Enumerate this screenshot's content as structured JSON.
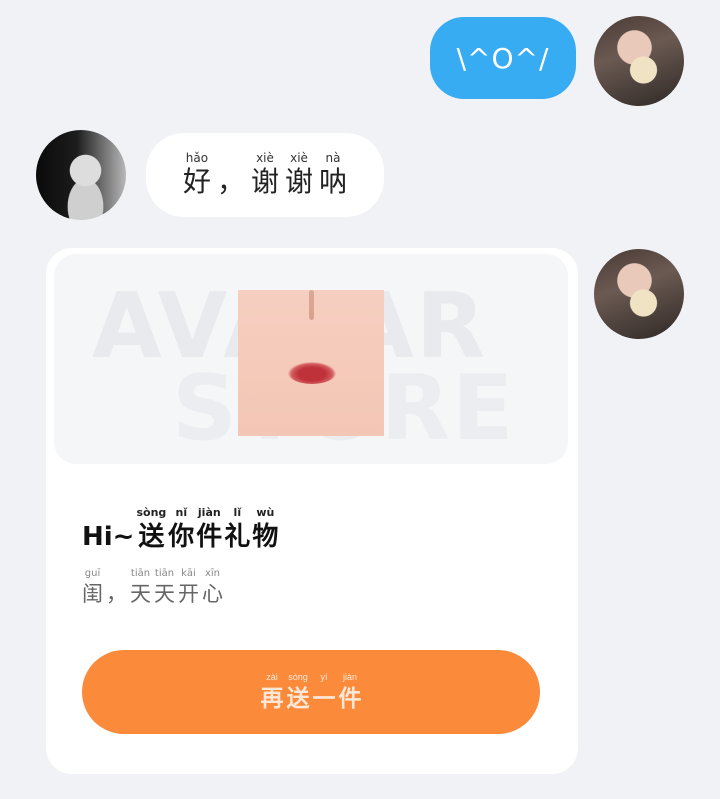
{
  "messages": {
    "outgoing_emoticon": "\\^O^/",
    "incoming_reply": [
      {
        "pinyin": "hǎo",
        "char": "好"
      },
      {
        "pinyin": "",
        "char": "，"
      },
      {
        "pinyin": "xiè",
        "char": "谢"
      },
      {
        "pinyin": "xiè",
        "char": "谢"
      },
      {
        "pinyin": "nà",
        "char": "呐"
      }
    ]
  },
  "gift_card": {
    "watermark_line1": "AVATAR",
    "watermark_line2": "STORE",
    "title_prefix": "Hi~",
    "title": [
      {
        "pinyin": "sòng",
        "char": "送"
      },
      {
        "pinyin": "nǐ",
        "char": "你"
      },
      {
        "pinyin": "jiàn",
        "char": "件"
      },
      {
        "pinyin": "lǐ",
        "char": "礼"
      },
      {
        "pinyin": "wù",
        "char": "物"
      }
    ],
    "subtitle": [
      {
        "pinyin": "guī",
        "char": "闺"
      },
      {
        "pinyin": "",
        "char": "，"
      },
      {
        "pinyin": "tiān",
        "char": "天"
      },
      {
        "pinyin": "tiān",
        "char": "天"
      },
      {
        "pinyin": "kāi",
        "char": "开"
      },
      {
        "pinyin": "xīn",
        "char": "心"
      }
    ],
    "button": [
      {
        "pinyin": "zài",
        "char": "再"
      },
      {
        "pinyin": "sòng",
        "char": "送"
      },
      {
        "pinyin": "yí",
        "char": "一"
      },
      {
        "pinyin": "jiàn",
        "char": "件"
      }
    ]
  },
  "colors": {
    "outgoing_bubble": "#37acf3",
    "button": "#fb8a3b",
    "background": "#f1f2f5"
  }
}
